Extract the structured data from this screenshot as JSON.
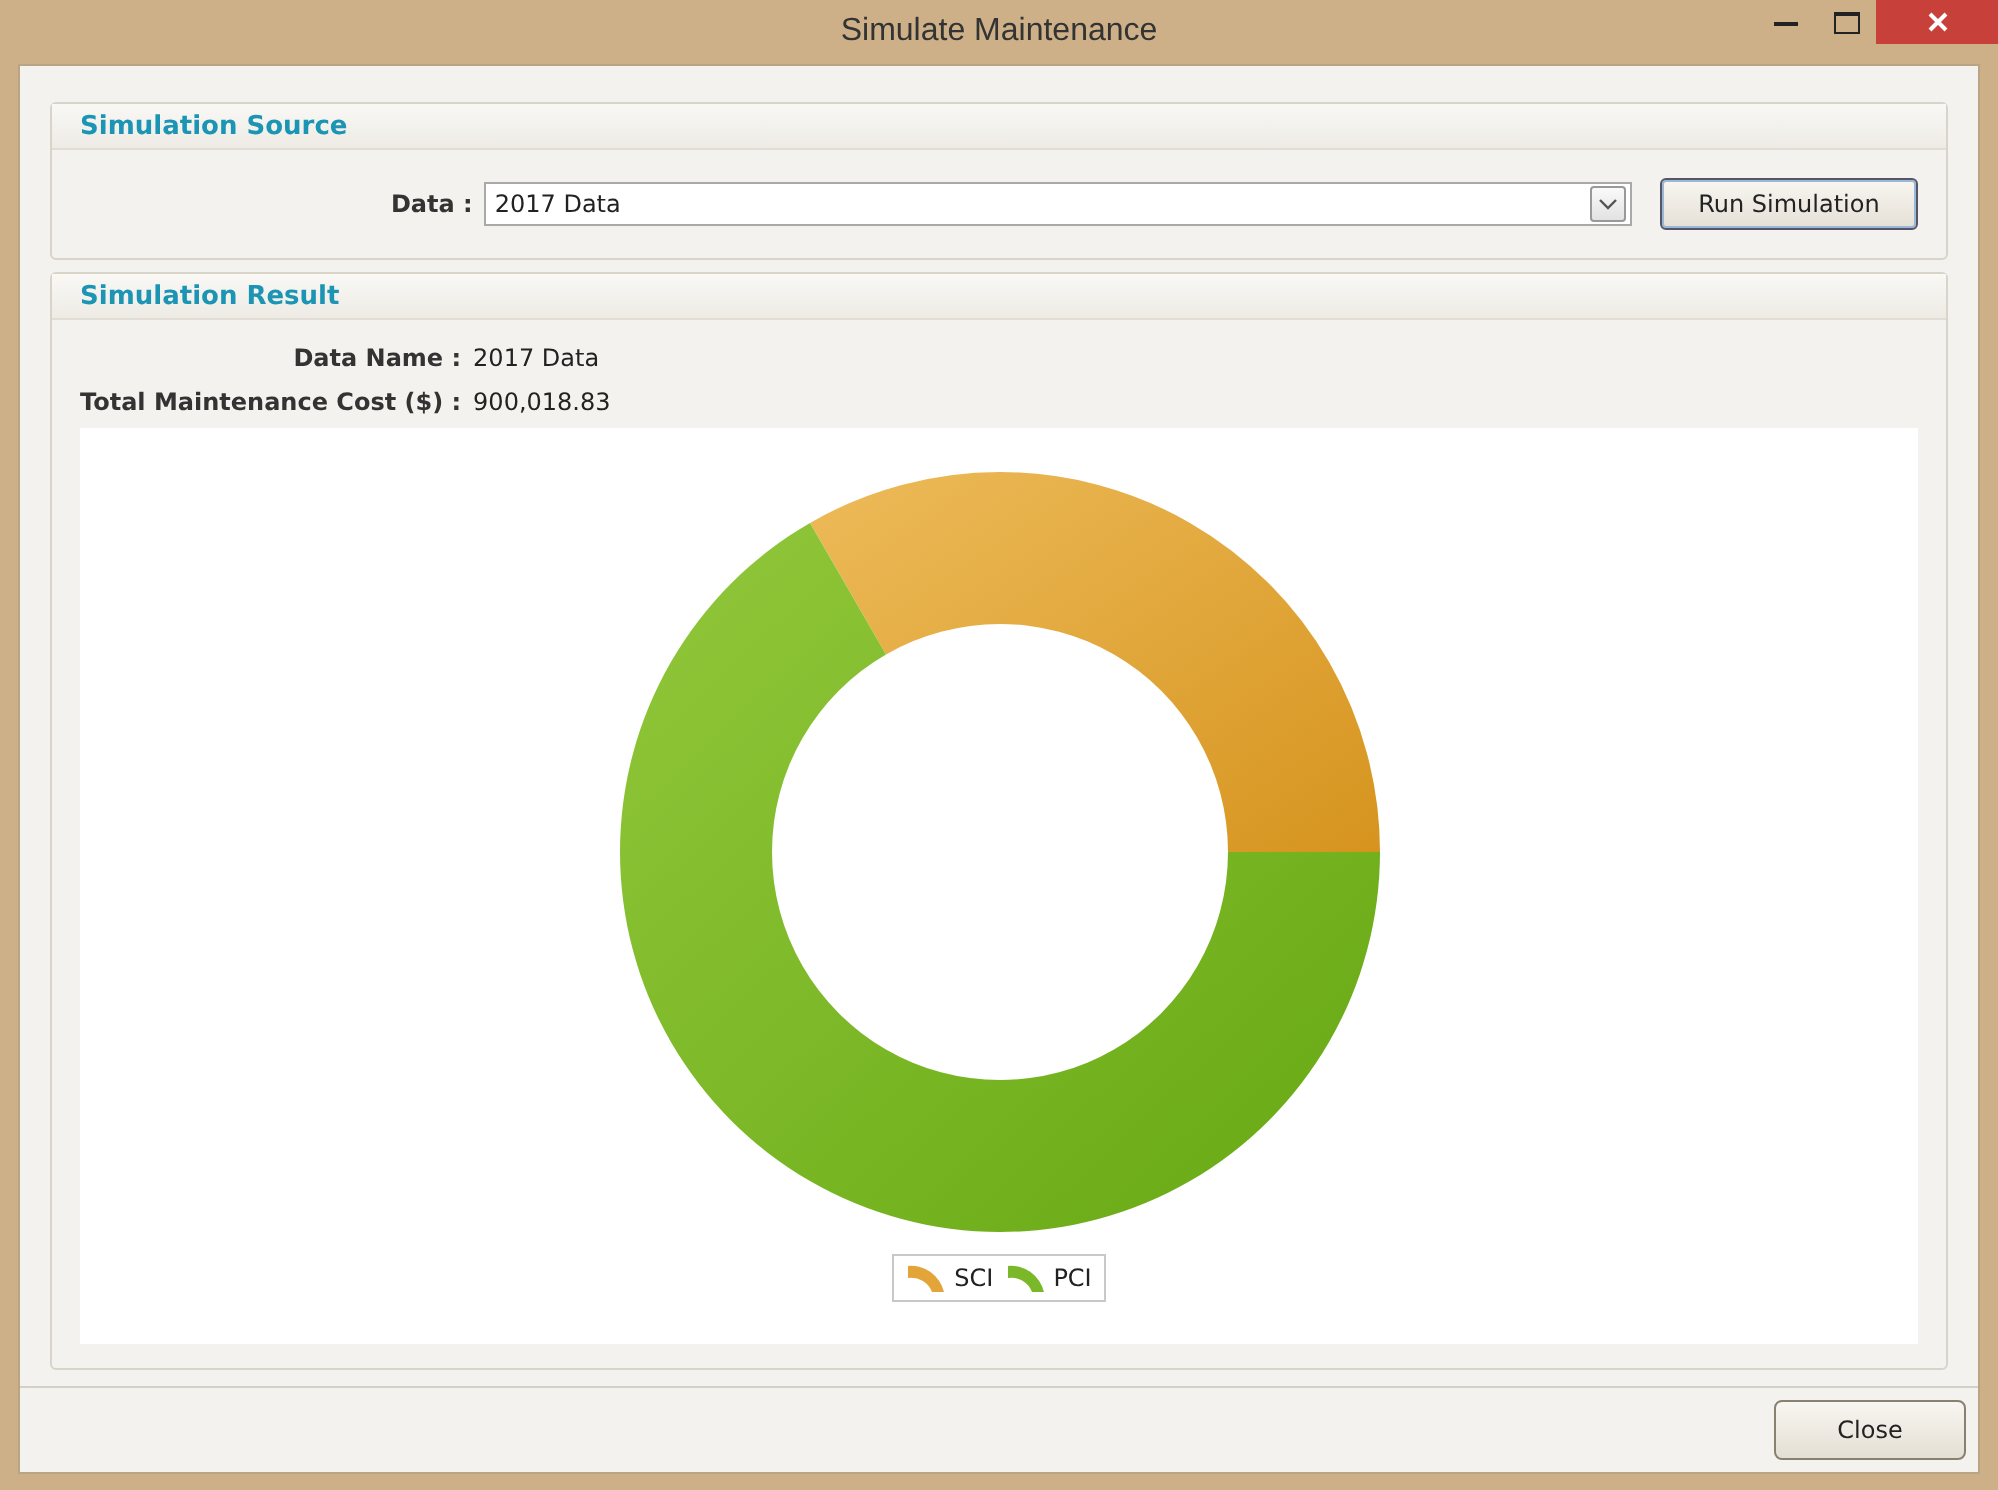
{
  "window": {
    "title": "Simulate Maintenance"
  },
  "source": {
    "title": "Simulation Source",
    "data_label": "Data :",
    "data_value": "2017 Data",
    "run_button": "Run Simulation"
  },
  "result": {
    "title": "Simulation Result",
    "fields": [
      {
        "label": "Data Name :",
        "value": "2017 Data"
      },
      {
        "label": "Total Maintenance Cost ($) :",
        "value": "900,018.83"
      }
    ],
    "legend": [
      {
        "label": "SCI",
        "color": "#e3a53a"
      },
      {
        "label": "PCI",
        "color": "#7ab82a"
      }
    ]
  },
  "close_button": "Close"
}
